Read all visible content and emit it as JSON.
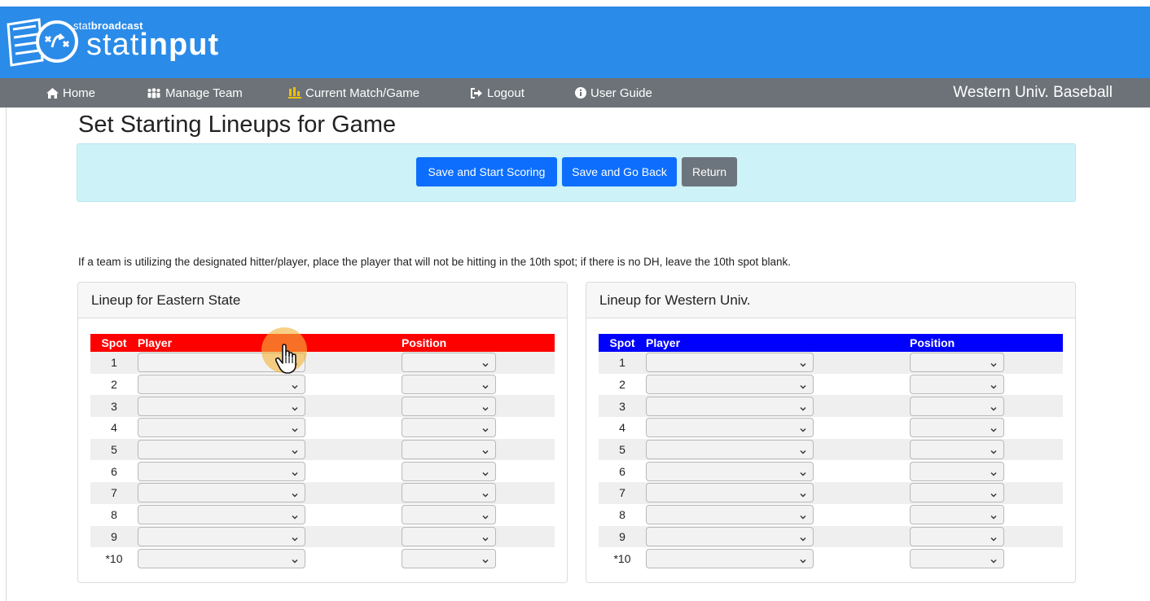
{
  "app": {
    "brand_prefix": "stat",
    "brand_prefix_bold": "broadcast",
    "brand_name": "stat",
    "brand_name_bold": "input",
    "logo_icon": "playbook-icon",
    "colors": {
      "header": "#2a8be8",
      "nav": "#6c7277",
      "primary": "#0d6efd",
      "secondary": "#6c757d",
      "away_table_header": "#ff0000",
      "home_table_header": "#0000ff",
      "alert_bg": "#cdf2f8"
    }
  },
  "nav": {
    "items": [
      {
        "label": "Home",
        "icon": "home-icon"
      },
      {
        "label": "Manage Team",
        "icon": "team-icon"
      },
      {
        "label": "Current Match/Game",
        "icon": "scoreboard-icon"
      },
      {
        "label": "Logout",
        "icon": "logout-icon"
      },
      {
        "label": "User Guide",
        "icon": "info-icon"
      }
    ],
    "team_name": "Western Univ. Baseball"
  },
  "page": {
    "title": "Set Starting Lineups for Game",
    "buttons": {
      "save_start": "Save and Start Scoring",
      "save_back": "Save and Go Back",
      "return": "Return"
    },
    "note": "If a team is utilizing the designated hitter/player, place the player that will not be hitting in the 10th spot; if there is no DH, leave the 10th spot blank."
  },
  "lineups": [
    {
      "title": "Lineup for Eastern State",
      "header": {
        "spot": "Spot",
        "player": "Player",
        "position": "Position"
      },
      "spots": [
        "1",
        "2",
        "3",
        "4",
        "5",
        "6",
        "7",
        "8",
        "9",
        "*10"
      ]
    },
    {
      "title": "Lineup for Western Univ.",
      "header": {
        "spot": "Spot",
        "player": "Player",
        "position": "Position"
      },
      "spots": [
        "1",
        "2",
        "3",
        "4",
        "5",
        "6",
        "7",
        "8",
        "9",
        "*10"
      ]
    }
  ]
}
